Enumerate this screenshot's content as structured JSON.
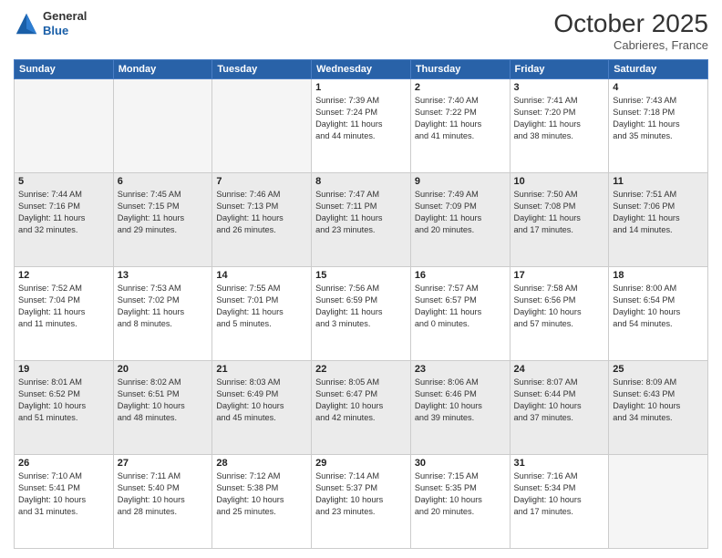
{
  "logo": {
    "general": "General",
    "blue": "Blue"
  },
  "title": "October 2025",
  "subtitle": "Cabrieres, France",
  "days_of_week": [
    "Sunday",
    "Monday",
    "Tuesday",
    "Wednesday",
    "Thursday",
    "Friday",
    "Saturday"
  ],
  "weeks": [
    [
      {
        "day": "",
        "info": ""
      },
      {
        "day": "",
        "info": ""
      },
      {
        "day": "",
        "info": ""
      },
      {
        "day": "1",
        "info": "Sunrise: 7:39 AM\nSunset: 7:24 PM\nDaylight: 11 hours\nand 44 minutes."
      },
      {
        "day": "2",
        "info": "Sunrise: 7:40 AM\nSunset: 7:22 PM\nDaylight: 11 hours\nand 41 minutes."
      },
      {
        "day": "3",
        "info": "Sunrise: 7:41 AM\nSunset: 7:20 PM\nDaylight: 11 hours\nand 38 minutes."
      },
      {
        "day": "4",
        "info": "Sunrise: 7:43 AM\nSunset: 7:18 PM\nDaylight: 11 hours\nand 35 minutes."
      }
    ],
    [
      {
        "day": "5",
        "info": "Sunrise: 7:44 AM\nSunset: 7:16 PM\nDaylight: 11 hours\nand 32 minutes."
      },
      {
        "day": "6",
        "info": "Sunrise: 7:45 AM\nSunset: 7:15 PM\nDaylight: 11 hours\nand 29 minutes."
      },
      {
        "day": "7",
        "info": "Sunrise: 7:46 AM\nSunset: 7:13 PM\nDaylight: 11 hours\nand 26 minutes."
      },
      {
        "day": "8",
        "info": "Sunrise: 7:47 AM\nSunset: 7:11 PM\nDaylight: 11 hours\nand 23 minutes."
      },
      {
        "day": "9",
        "info": "Sunrise: 7:49 AM\nSunset: 7:09 PM\nDaylight: 11 hours\nand 20 minutes."
      },
      {
        "day": "10",
        "info": "Sunrise: 7:50 AM\nSunset: 7:08 PM\nDaylight: 11 hours\nand 17 minutes."
      },
      {
        "day": "11",
        "info": "Sunrise: 7:51 AM\nSunset: 7:06 PM\nDaylight: 11 hours\nand 14 minutes."
      }
    ],
    [
      {
        "day": "12",
        "info": "Sunrise: 7:52 AM\nSunset: 7:04 PM\nDaylight: 11 hours\nand 11 minutes."
      },
      {
        "day": "13",
        "info": "Sunrise: 7:53 AM\nSunset: 7:02 PM\nDaylight: 11 hours\nand 8 minutes."
      },
      {
        "day": "14",
        "info": "Sunrise: 7:55 AM\nSunset: 7:01 PM\nDaylight: 11 hours\nand 5 minutes."
      },
      {
        "day": "15",
        "info": "Sunrise: 7:56 AM\nSunset: 6:59 PM\nDaylight: 11 hours\nand 3 minutes."
      },
      {
        "day": "16",
        "info": "Sunrise: 7:57 AM\nSunset: 6:57 PM\nDaylight: 11 hours\nand 0 minutes."
      },
      {
        "day": "17",
        "info": "Sunrise: 7:58 AM\nSunset: 6:56 PM\nDaylight: 10 hours\nand 57 minutes."
      },
      {
        "day": "18",
        "info": "Sunrise: 8:00 AM\nSunset: 6:54 PM\nDaylight: 10 hours\nand 54 minutes."
      }
    ],
    [
      {
        "day": "19",
        "info": "Sunrise: 8:01 AM\nSunset: 6:52 PM\nDaylight: 10 hours\nand 51 minutes."
      },
      {
        "day": "20",
        "info": "Sunrise: 8:02 AM\nSunset: 6:51 PM\nDaylight: 10 hours\nand 48 minutes."
      },
      {
        "day": "21",
        "info": "Sunrise: 8:03 AM\nSunset: 6:49 PM\nDaylight: 10 hours\nand 45 minutes."
      },
      {
        "day": "22",
        "info": "Sunrise: 8:05 AM\nSunset: 6:47 PM\nDaylight: 10 hours\nand 42 minutes."
      },
      {
        "day": "23",
        "info": "Sunrise: 8:06 AM\nSunset: 6:46 PM\nDaylight: 10 hours\nand 39 minutes."
      },
      {
        "day": "24",
        "info": "Sunrise: 8:07 AM\nSunset: 6:44 PM\nDaylight: 10 hours\nand 37 minutes."
      },
      {
        "day": "25",
        "info": "Sunrise: 8:09 AM\nSunset: 6:43 PM\nDaylight: 10 hours\nand 34 minutes."
      }
    ],
    [
      {
        "day": "26",
        "info": "Sunrise: 7:10 AM\nSunset: 5:41 PM\nDaylight: 10 hours\nand 31 minutes."
      },
      {
        "day": "27",
        "info": "Sunrise: 7:11 AM\nSunset: 5:40 PM\nDaylight: 10 hours\nand 28 minutes."
      },
      {
        "day": "28",
        "info": "Sunrise: 7:12 AM\nSunset: 5:38 PM\nDaylight: 10 hours\nand 25 minutes."
      },
      {
        "day": "29",
        "info": "Sunrise: 7:14 AM\nSunset: 5:37 PM\nDaylight: 10 hours\nand 23 minutes."
      },
      {
        "day": "30",
        "info": "Sunrise: 7:15 AM\nSunset: 5:35 PM\nDaylight: 10 hours\nand 20 minutes."
      },
      {
        "day": "31",
        "info": "Sunrise: 7:16 AM\nSunset: 5:34 PM\nDaylight: 10 hours\nand 17 minutes."
      },
      {
        "day": "",
        "info": ""
      }
    ]
  ]
}
